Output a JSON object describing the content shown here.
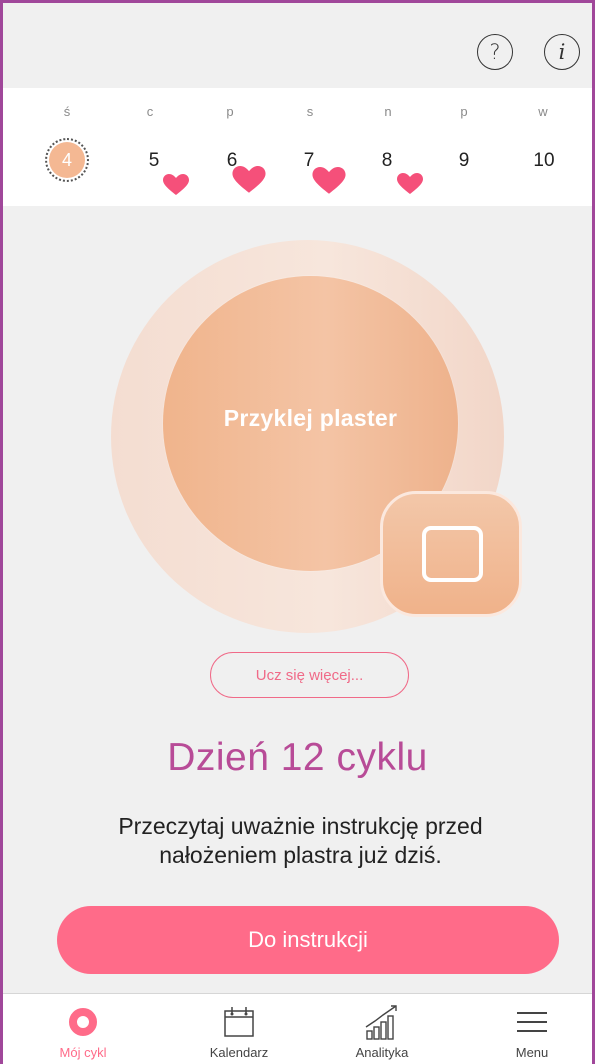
{
  "top_bar": {
    "help_icon_glyph": "?",
    "info_icon_glyph": "i"
  },
  "week": {
    "days": [
      {
        "name": "ś",
        "num": "4",
        "today": true,
        "heart": null
      },
      {
        "name": "c",
        "num": "5",
        "heart": "small"
      },
      {
        "name": "p",
        "num": "6",
        "heart": "large"
      },
      {
        "name": "s",
        "num": "7",
        "heart": "large"
      },
      {
        "name": "n",
        "num": "8",
        "heart": "small"
      },
      {
        "name": "p",
        "num": "9",
        "heart": null
      },
      {
        "name": "w",
        "num": "10",
        "heart": null
      }
    ]
  },
  "main": {
    "circle_label": "Przyklej plaster",
    "learn_more": "Ucz się więcej...",
    "day_title": "Dzień 12 cyklu",
    "description_line1": "Przeczytaj uważnie instrukcję przed",
    "description_line2": "nałożeniem plastra już dziś.",
    "primary_button": "Do instrukcji"
  },
  "nav": {
    "items": [
      {
        "label": "Mój cykl",
        "icon": "cycle-ring-icon",
        "active": true
      },
      {
        "label": "Kalendarz",
        "icon": "calendar-icon",
        "active": false
      },
      {
        "label": "Analityka",
        "icon": "analytics-chart-icon",
        "active": false
      },
      {
        "label": "Menu",
        "icon": "hamburger-menu-icon",
        "active": false
      }
    ]
  },
  "colors": {
    "accent_pink": "#ff6b89",
    "title_magenta": "#b84b97",
    "peach": "#f4b893",
    "frame_border": "#a0479a"
  }
}
